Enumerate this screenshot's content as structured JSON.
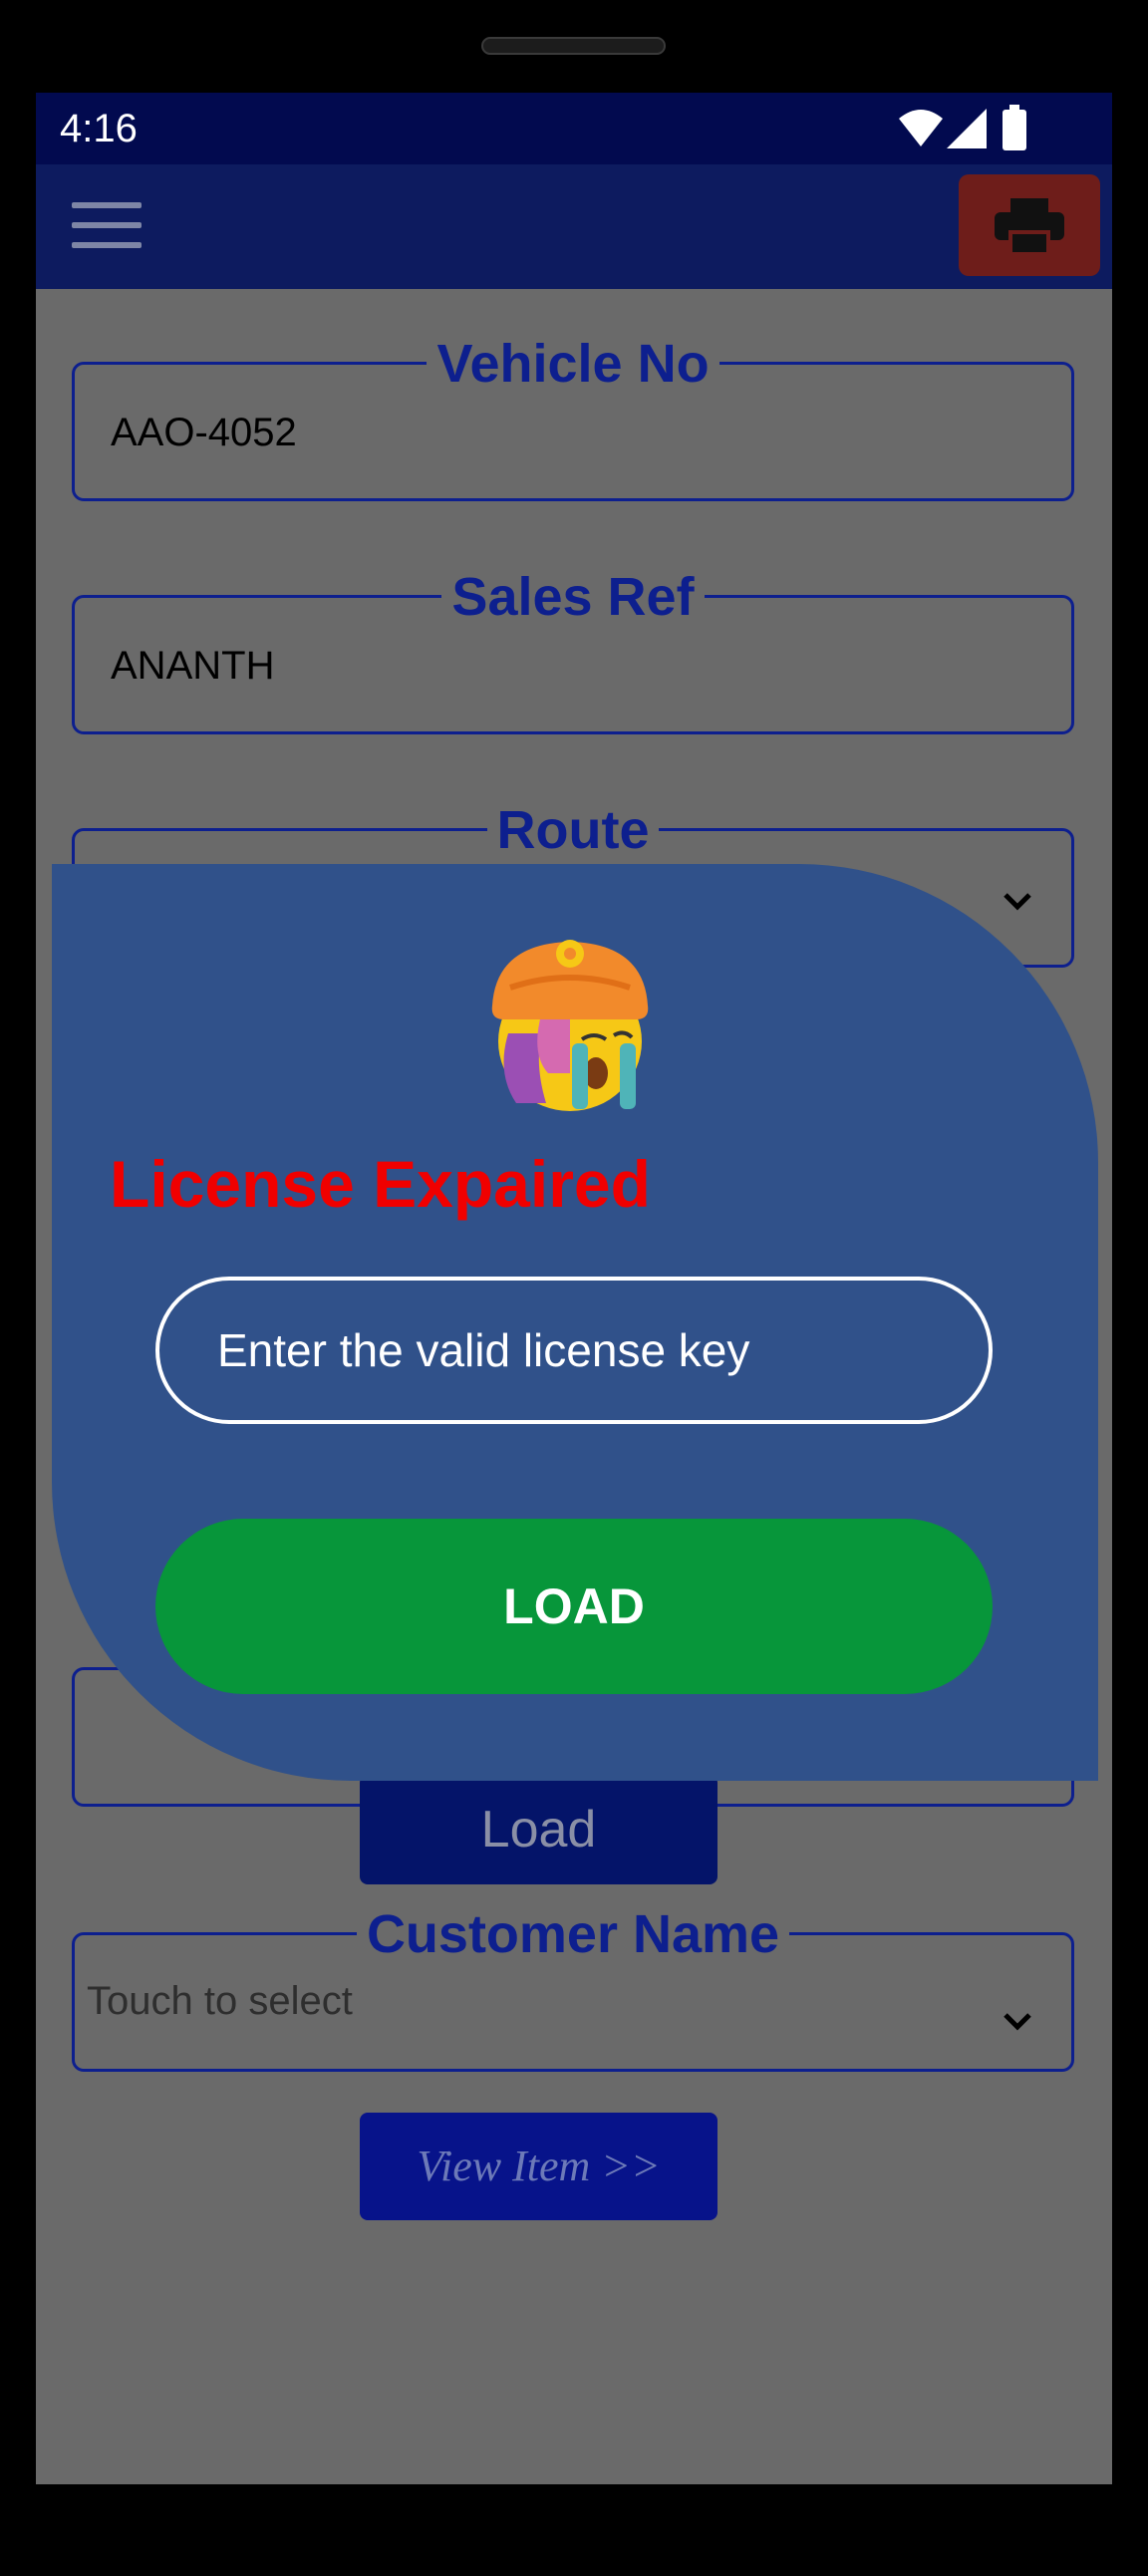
{
  "status_bar": {
    "time": "4:16"
  },
  "form": {
    "vehicle_no": {
      "label": "Vehicle No",
      "value": "AAO-4052"
    },
    "sales_ref": {
      "label": "Sales Ref",
      "value": "ANANTH"
    },
    "route": {
      "label": "Route",
      "value": ""
    },
    "load_button": "Load",
    "customer_name": {
      "label": "Customer Name",
      "value": "Touch to select"
    },
    "view_item_button": "View Item >>"
  },
  "license_dialog": {
    "title": "License Expaired",
    "input_placeholder": "Enter the valid license key",
    "load_button": "LOAD"
  },
  "colors": {
    "status_bar": "#020a4f",
    "app_bar": "#0d1b5f",
    "print_button": "#6e1d1a",
    "field_border": "#0d1f8e",
    "dialog_bg": "#30518a",
    "dialog_title": "#f00000",
    "dialog_button": "#07963a"
  },
  "icons": [
    "wifi-icon",
    "cellular-signal-icon",
    "battery-icon",
    "hamburger-menu-icon",
    "printer-icon",
    "crying-face-emoji-icon",
    "chevron-down-icon"
  ]
}
